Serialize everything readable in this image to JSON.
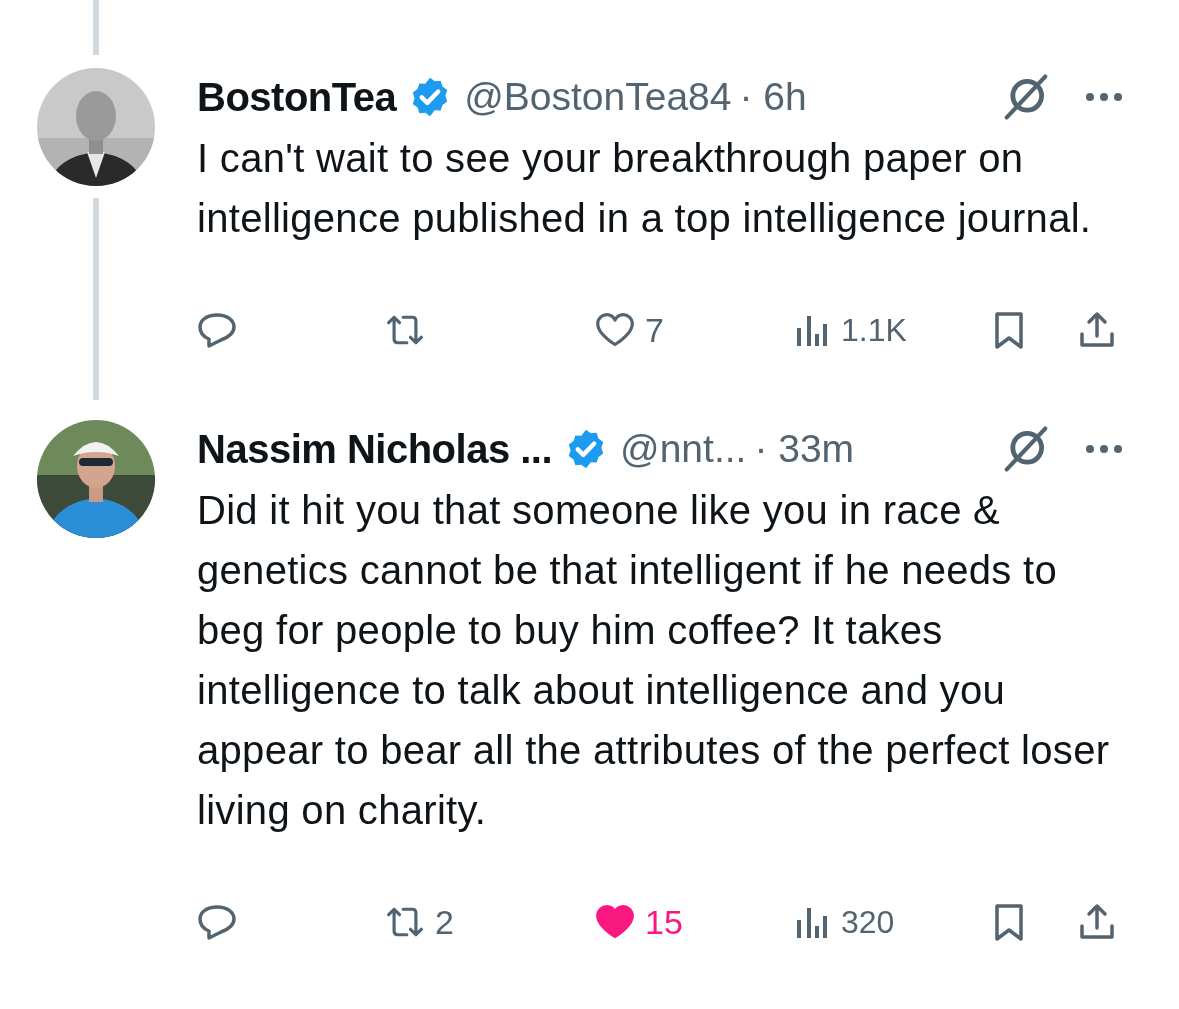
{
  "tweets": [
    {
      "name": "BostonTea",
      "verified": true,
      "handle": "@BostonTea84",
      "time": "· 6h",
      "text": "I can't wait to see your breakthrough paper on intelligence published in a top intelligence journal.",
      "thread_above": true,
      "thread_below": true,
      "like_count": "7",
      "liked": false,
      "views": "1.1K"
    },
    {
      "name": "Nassim Nicholas ...",
      "verified": true,
      "handle": "@nnt...",
      "time": "· 33m",
      "text": "Did it hit you that someone like you in race & genetics cannot be that intelligent if he needs to beg for people to buy him coffee? It takes intelligence to talk about intelligence and you appear to bear all the attributes of the perfect loser living on charity.",
      "repost_count": "2",
      "like_count": "15",
      "liked": true,
      "views": "320"
    }
  ]
}
